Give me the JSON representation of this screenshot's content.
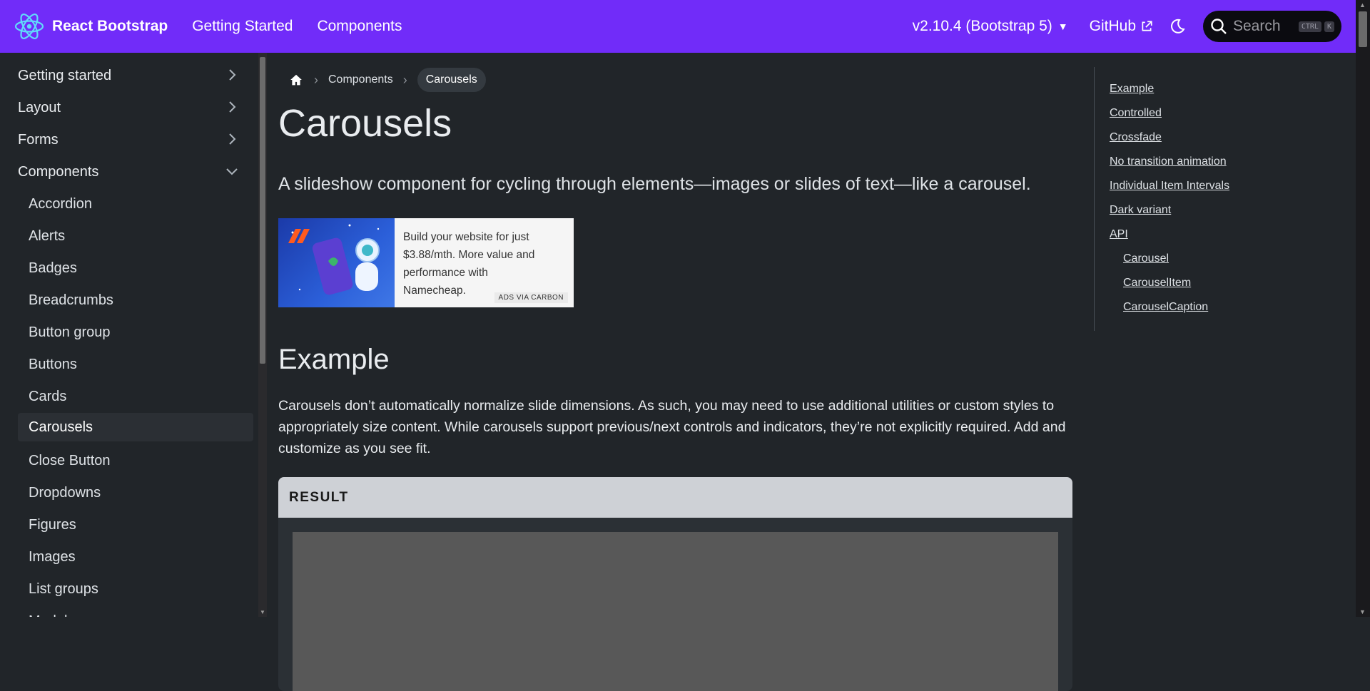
{
  "navbar": {
    "brand": "React Bootstrap",
    "links": [
      "Getting Started",
      "Components"
    ],
    "version": "v2.10.4 (Bootstrap 5)",
    "github": "GitHub",
    "search_placeholder": "Search",
    "search_keys": [
      "CTRL",
      "K"
    ]
  },
  "sidebar": {
    "sections": [
      {
        "label": "Getting started",
        "icon": "chevron-right-icon"
      },
      {
        "label": "Layout",
        "icon": "chevron-right-icon"
      },
      {
        "label": "Forms",
        "icon": "chevron-right-icon"
      },
      {
        "label": "Components",
        "icon": "chevron-down-icon"
      }
    ],
    "items": [
      "Accordion",
      "Alerts",
      "Badges",
      "Breadcrumbs",
      "Button group",
      "Buttons",
      "Cards",
      "Carousels",
      "Close Button",
      "Dropdowns",
      "Figures",
      "Images",
      "List groups",
      "Modals"
    ],
    "active": "Carousels"
  },
  "breadcrumb": {
    "items": [
      "Components"
    ],
    "current": "Carousels"
  },
  "page": {
    "title": "Carousels",
    "lead": "A slideshow component for cycling through elements—images or slides of text—like a carousel.",
    "ad_text": "Build your website for just $3.88/mth. More value and performance with Namecheap.",
    "ad_via": "ADS VIA CARBON",
    "section_title": "Example",
    "section_text": "Carousels don’t automatically normalize slide dimensions. As such, you may need to use additional utilities or custom styles to appropriately size content. While carousels support previous/next controls and indicators, they’re not explicitly required. Add and customize as you see fit.",
    "result_label": "RESULT"
  },
  "toc": {
    "items": [
      "Example",
      "Controlled",
      "Crossfade",
      "No transition animation",
      "Individual Item Intervals",
      "Dark variant",
      "API"
    ],
    "sub_items": [
      "Carousel",
      "CarouselItem",
      "CarouselCaption"
    ]
  },
  "colors": {
    "accent": "#712cf9",
    "background": "#212529"
  }
}
